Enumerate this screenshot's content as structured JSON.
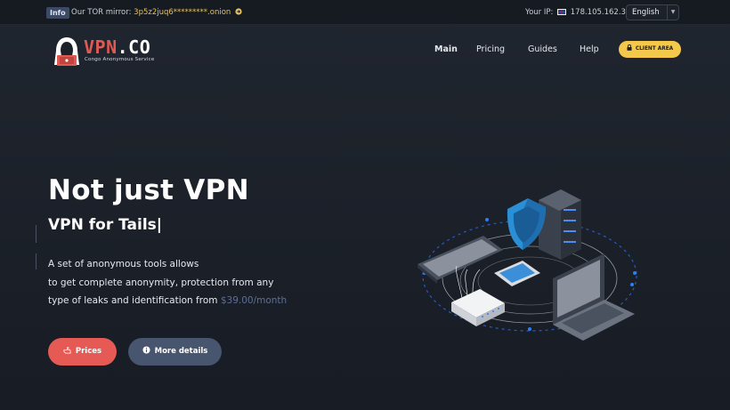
{
  "topbar": {
    "badge": "Info",
    "tor_label": "Our TOR mirror:",
    "tor_address": "3p5z2juq6*********.onion",
    "ip_label": "Your IP:",
    "ip_value": "178.105.162.38",
    "language": "English"
  },
  "header": {
    "brand_main": "VPN",
    "brand_dot": ".CO",
    "tagline": "Congo Anonymous Service",
    "nav": [
      "Main",
      "Pricing",
      "Guides",
      "Help"
    ],
    "client_area": "CLIENT AREA"
  },
  "hero": {
    "title": "Not just VPN",
    "subtitle": "VPN for Tails|",
    "desc_line1": "A set of anonymous tools allows",
    "desc_line2": "to get complete anonymity, protection from any",
    "desc_line3": "type of leaks and identification from ",
    "price": "$39.00/month",
    "btn_prices": "Prices",
    "btn_more": "More details"
  },
  "colors": {
    "accent_red": "#e55a54",
    "accent_yellow": "#f4c84a",
    "secondary_button": "#48556e",
    "background": "#1b2029"
  },
  "icons": [
    "info-badge",
    "arrow-circle-right-icon",
    "uk-flag-icon",
    "chevron-down-icon",
    "hacker-logo-icon",
    "lock-icon",
    "hand-pointer-icon",
    "info-circle-icon"
  ]
}
